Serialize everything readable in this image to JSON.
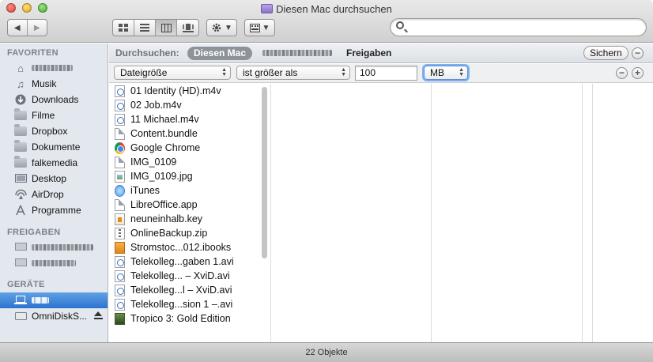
{
  "window": {
    "title": "Diesen Mac durchsuchen"
  },
  "toolbar": {
    "back_icon": "chevron-left-icon",
    "forward_icon": "chevron-right-icon",
    "view_modes": [
      "icon-view",
      "list-view",
      "column-view",
      "coverflow-view"
    ],
    "active_view": "column-view",
    "action_icon": "gear-icon",
    "arrange_icon": "arrange-grid-icon",
    "search_value": ""
  },
  "sidebar": {
    "favorites_header": "FAVORITEN",
    "favorites": [
      {
        "label": "",
        "icon": "home-icon",
        "blurred": true
      },
      {
        "label": "Musik",
        "icon": "music-icon"
      },
      {
        "label": "Downloads",
        "icon": "downloads-icon"
      },
      {
        "label": "Filme",
        "icon": "folder-icon"
      },
      {
        "label": "Dropbox",
        "icon": "folder-icon"
      },
      {
        "label": "Dokumente",
        "icon": "folder-icon"
      },
      {
        "label": "falkemedia",
        "icon": "folder-icon"
      },
      {
        "label": "Desktop",
        "icon": "desktop-icon"
      },
      {
        "label": "AirDrop",
        "icon": "airdrop-icon"
      },
      {
        "label": "Programme",
        "icon": "applications-icon"
      }
    ],
    "shares_header": "FREIGABEN",
    "devices_header": "GERÄTE",
    "devices": [
      {
        "label": "",
        "icon": "laptop-icon",
        "blurred": true,
        "selected": true
      },
      {
        "label": "OmniDiskS...",
        "icon": "disk-icon",
        "ejectable": true
      }
    ]
  },
  "scopebar": {
    "label": "Durchsuchen:",
    "active_scope": "Diesen Mac",
    "shares_scope": "Freigaben",
    "save_label": "Sichern"
  },
  "criteria": {
    "attribute": "Dateigröße",
    "operator": "ist größer als",
    "value": "100",
    "unit": "MB"
  },
  "files": [
    {
      "name": "01 Identity (HD).m4v",
      "icon": "movie-file-icon"
    },
    {
      "name": "02 Job.m4v",
      "icon": "movie-file-icon"
    },
    {
      "name": "11 Michael.m4v",
      "icon": "movie-file-icon"
    },
    {
      "name": "Content.bundle",
      "icon": "document-icon"
    },
    {
      "name": "Google Chrome",
      "icon": "chrome-icon"
    },
    {
      "name": "IMG_0109",
      "icon": "document-icon"
    },
    {
      "name": "IMG_0109.jpg",
      "icon": "image-file-icon"
    },
    {
      "name": "iTunes",
      "icon": "itunes-icon"
    },
    {
      "name": "LibreOffice.app",
      "icon": "document-icon"
    },
    {
      "name": "neuneinhalb.key",
      "icon": "keynote-icon"
    },
    {
      "name": "OnlineBackup.zip",
      "icon": "zip-icon"
    },
    {
      "name": "Stromstoc...012.ibooks",
      "icon": "ibooks-icon"
    },
    {
      "name": "Telekolleg...gaben 1.avi",
      "icon": "movie-file-icon"
    },
    {
      "name": "Telekolleg... – XviD.avi",
      "icon": "movie-file-icon"
    },
    {
      "name": "Telekolleg...l – XviD.avi",
      "icon": "movie-file-icon"
    },
    {
      "name": "Telekolleg...sion 1 –.avi",
      "icon": "movie-file-icon"
    },
    {
      "name": "Tropico 3: Gold Edition",
      "icon": "game-icon"
    }
  ],
  "status": {
    "count_text": "22 Objekte"
  }
}
